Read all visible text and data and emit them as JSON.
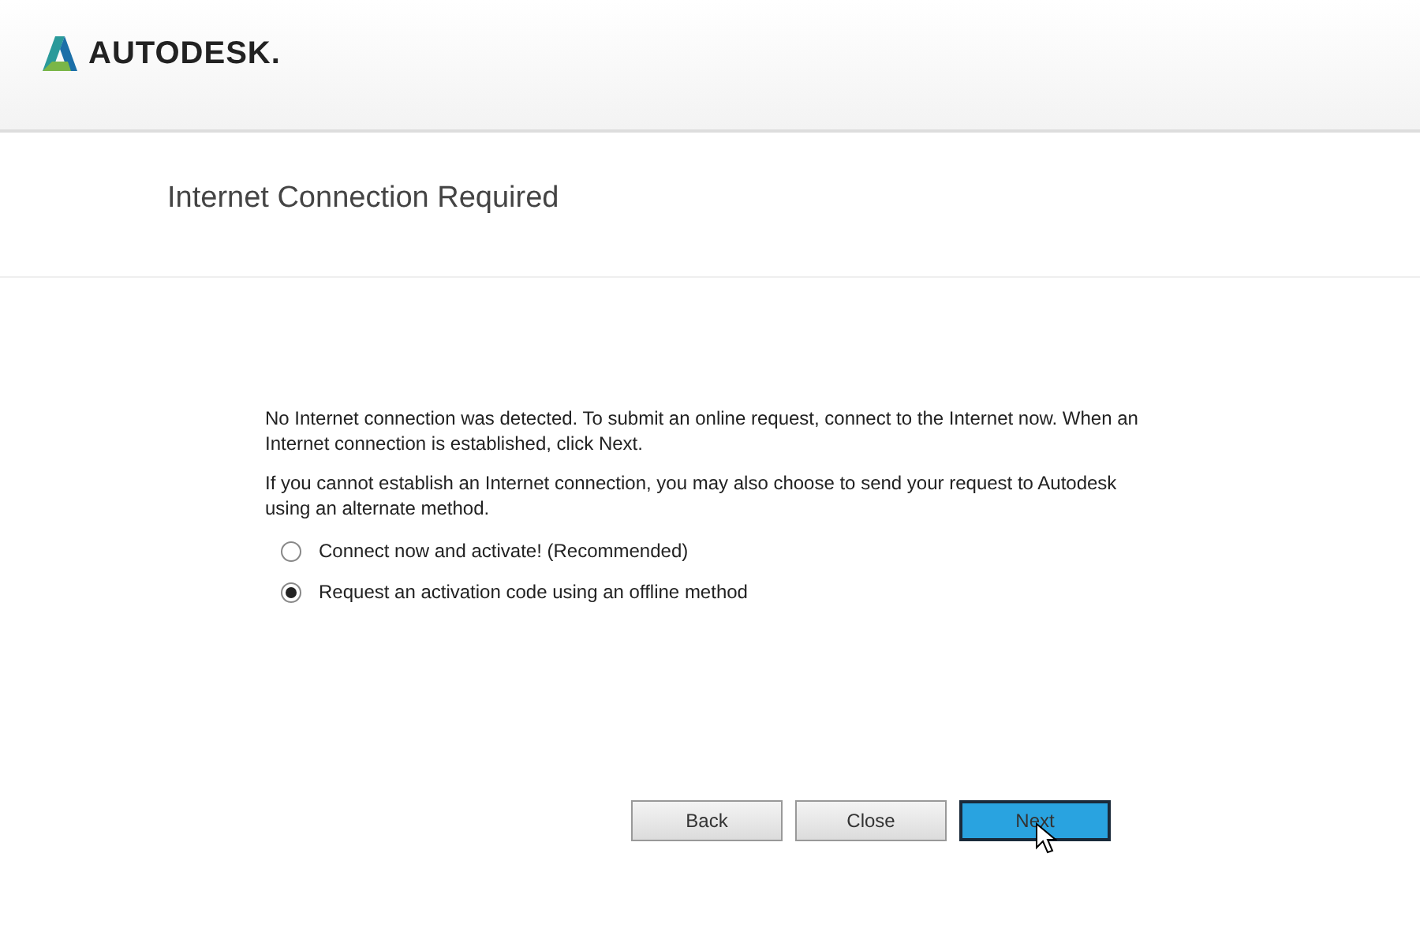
{
  "header": {
    "logo_text": "AUTODESK."
  },
  "page_title": "Internet Connection Required",
  "paragraphs": [
    "No Internet connection was detected. To submit an online request, connect to the Internet now. When an Internet connection is established, click Next.",
    "If you cannot establish an Internet connection, you may also choose to send your request to Autodesk using an alternate method."
  ],
  "options": [
    {
      "label": "Connect now and activate! (Recommended)",
      "selected": false
    },
    {
      "label": "Request an activation code using an offline method",
      "selected": true
    }
  ],
  "buttons": [
    {
      "label": "Back",
      "kind": "default"
    },
    {
      "label": "Close",
      "kind": "default"
    },
    {
      "label": "Next",
      "kind": "primary"
    }
  ]
}
